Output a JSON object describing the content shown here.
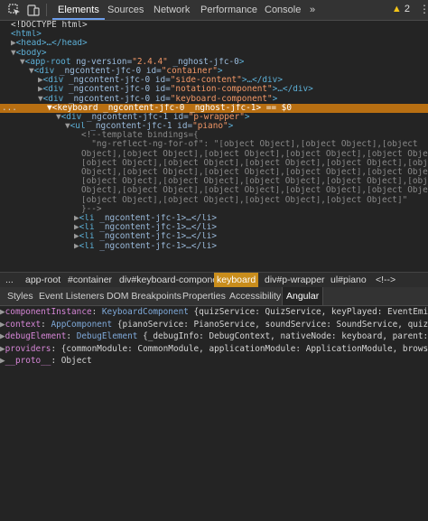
{
  "toolbar": {
    "tabs": [
      "Elements",
      "Sources",
      "Network",
      "Performance",
      "Console"
    ],
    "more": "»",
    "warning_count": "2"
  },
  "dom": {
    "doctype": "<!DOCTYPE html>",
    "html": "<html>",
    "head": "<head>…</head>",
    "body": "<body>",
    "app_root": {
      "tag": "app-root",
      "attr1": "ng-version",
      "val1": "\"2.4.4\"",
      "attr2": "_nghost-jfc-0"
    },
    "container": {
      "attr": "_ngcontent-jfc-0 id=",
      "val": "\"container\""
    },
    "side_content": {
      "val": "\"side-content\"",
      "tail": ">…</div>"
    },
    "notation": {
      "val": "\"notation-component\"",
      "tail": ">…</div>"
    },
    "keyboard_component": {
      "val": "\"keyboard-component\"",
      "tail": ">"
    },
    "selected": {
      "tag": "keyboard",
      "attrs": "_ngcontent-jfc-0 _nghost-jfc-1",
      "tail": "> == $0",
      "dots": "..."
    },
    "p_wrapper": {
      "attr": "_ngcontent-jfc-1 id=",
      "val": "\"p-wrapper\""
    },
    "piano": {
      "attr": "_ngcontent-jfc-1 id=",
      "val": "\"piano\""
    },
    "comment_lines": [
      "<!--template bindings={",
      "  \"ng-reflect-ng-for-of\": \"[object Object],[object Object],[object",
      "Object],[object Object],[object Object],[object Object],[object Object],",
      "[object Object],[object Object],[object Object],[object Object],[object",
      "Object],[object Object],[object Object],[object Object],[object Object],",
      "[object Object],[object Object],[object Object],[object Object],[object",
      "Object],[object Object],[object Object],[object Object],[object Object],",
      "[object Object],[object Object],[object Object],[object Object]\"",
      "}-->"
    ],
    "li_line": "_ngcontent-jfc-1>…</li>"
  },
  "breadcrumbs": [
    "...",
    "app-root",
    "#container",
    "div#keyboard-component",
    "keyboard",
    "div#p-wrapper",
    "ul#piano",
    "<!-->"
  ],
  "subtabs": [
    "Styles",
    "Event Listeners",
    "DOM Breakpoints",
    "Properties",
    "Accessibility",
    "Angular"
  ],
  "properties": [
    {
      "key": "componentInstance",
      "type": "KeyboardComponent",
      "value": "{quizService: QuizService, keyPlayed: EventEmitter,"
    },
    {
      "key": "context",
      "type": "AppComponent",
      "value": "{pianoService: PianoService, soundService: SoundService, quizServi"
    },
    {
      "key": "debugElement",
      "type": "DebugElement",
      "value": "{_debugInfo: DebugContext, nativeNode: keyboard, parent: Debu"
    },
    {
      "key": "providers",
      "type": "",
      "value": "{commonModule: CommonModule, applicationModule: ApplicationModule, browserMo"
    },
    {
      "key": "__proto__",
      "type": "",
      "value": "Object"
    }
  ],
  "colors": {
    "selected_row": "#b86f12",
    "active_crumb": "#c98d1c",
    "tag": "#5db0d7",
    "attr_value": "#f29766"
  }
}
